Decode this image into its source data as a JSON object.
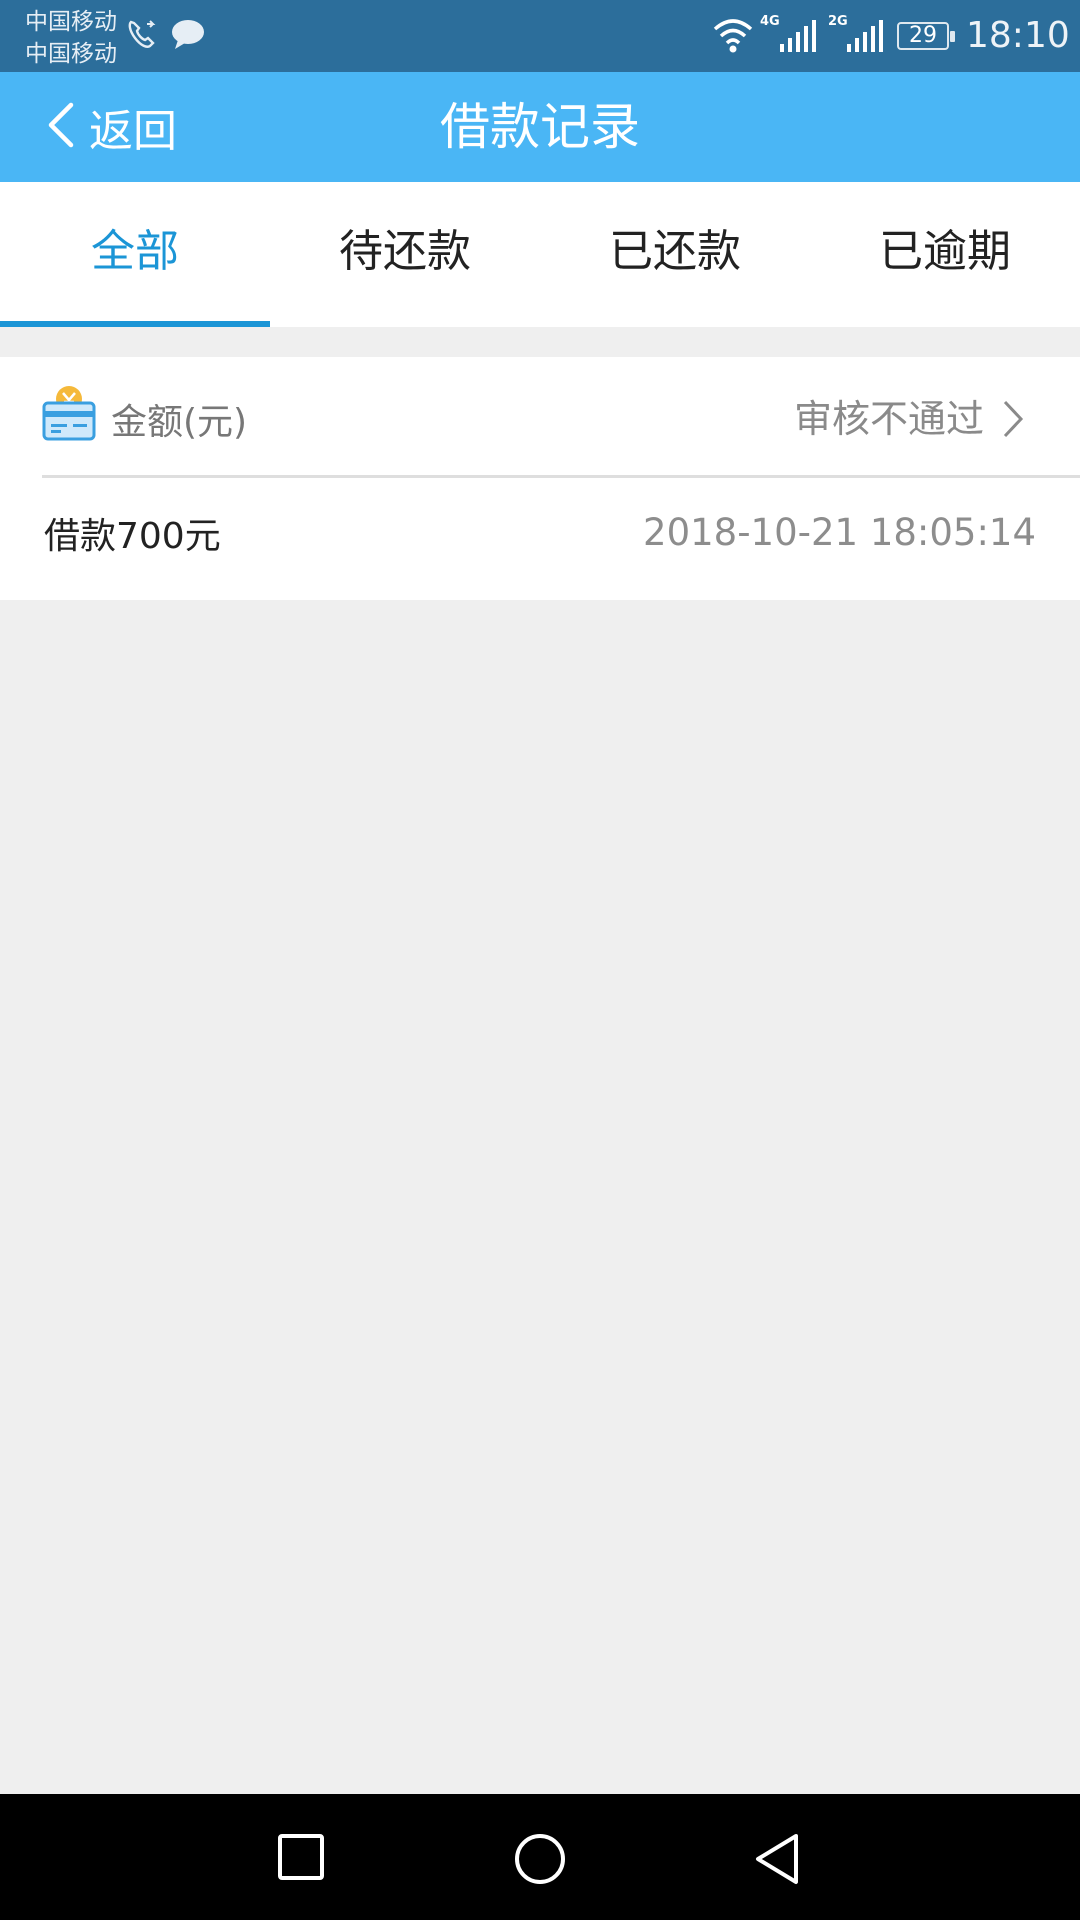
{
  "status_bar": {
    "carrier_1": "中国移动",
    "carrier_2": "中国移动",
    "network_1": "4G",
    "network_2": "2G",
    "battery": "29",
    "time": "18:10",
    "icons": [
      "call-icon",
      "message-icon",
      "wifi-icon",
      "signal-icon",
      "battery-icon"
    ]
  },
  "header": {
    "back_label": "返回",
    "title": "借款记录",
    "background_color": "#4ab6f5"
  },
  "tabs": [
    {
      "label": "全部",
      "active": true
    },
    {
      "label": "待还款",
      "active": false
    },
    {
      "label": "已还款",
      "active": false
    },
    {
      "label": "已逾期",
      "active": false
    }
  ],
  "accent_color": "#1b95d6",
  "record": {
    "amount_label": "金额(元)",
    "status": "审核不通过",
    "loan_text": "借款700元",
    "datetime": "2018-10-21 18:05:14"
  },
  "nav_bar": {
    "buttons": [
      "recent-apps",
      "home",
      "back"
    ]
  }
}
